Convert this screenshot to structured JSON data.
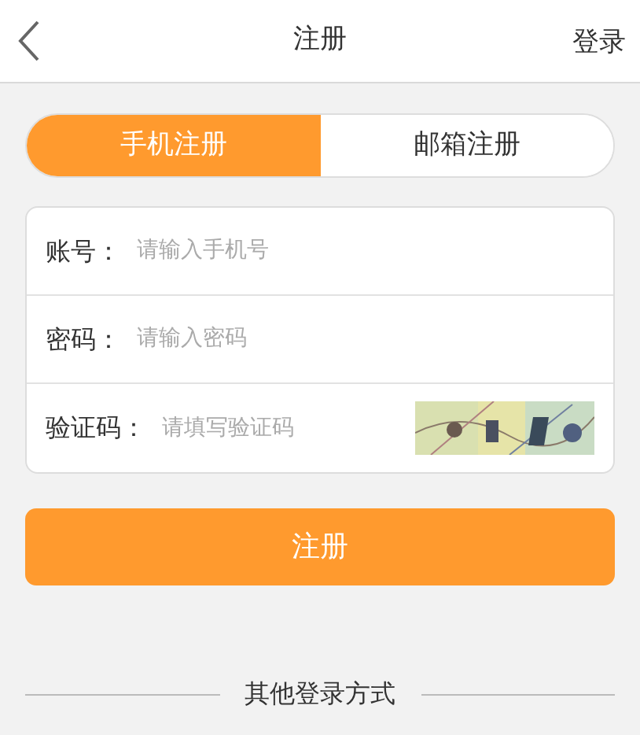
{
  "header": {
    "title": "注册",
    "right_link": "登录"
  },
  "tabs": [
    {
      "label": "手机注册",
      "selected": true
    },
    {
      "label": "邮箱注册",
      "selected": false
    }
  ],
  "fields": [
    {
      "label": "账号：",
      "placeholder": "请输入手机号",
      "kind": "text"
    },
    {
      "label": "密码：",
      "placeholder": "请输入密码",
      "kind": "password"
    },
    {
      "label": "验证码：",
      "placeholder": "请填写验证码",
      "kind": "captcha"
    }
  ],
  "submit": "注册",
  "other_login": "其他登录方式"
}
